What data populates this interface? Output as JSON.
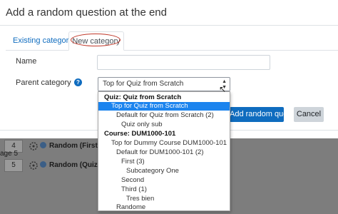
{
  "modal": {
    "title": "Add a random question at the end",
    "tabs": [
      {
        "label": "Existing category"
      },
      {
        "label": "New category"
      }
    ],
    "form": {
      "name_label": "Name",
      "name_value": "",
      "parent_label": "Parent category",
      "help_icon": "?",
      "parent_selected": "Top for Quiz from Scratch",
      "options": [
        {
          "label": "Quiz: Quiz from Scratch",
          "group": true
        },
        {
          "label": "Top for Quiz from Scratch",
          "selected": true
        },
        {
          "label": "Default for Quiz from Scratch (2)"
        },
        {
          "label": "Quiz only sub"
        },
        {
          "label": "Course: DUM1000-101",
          "group": true
        },
        {
          "label": "Top for Dummy Course DUM1000-101"
        },
        {
          "label": "Default for DUM1000-101 (2)"
        },
        {
          "label": "First (3)"
        },
        {
          "label": "Subcategory One"
        },
        {
          "label": "Second"
        },
        {
          "label": "Third (1)"
        },
        {
          "label": "Tres bien"
        },
        {
          "label": "Randome"
        }
      ]
    },
    "buttons": {
      "add_label": "Add random question",
      "cancel_label": "Cancel"
    }
  },
  "background": {
    "page_label": "age 5",
    "rows": [
      {
        "number": "4",
        "text": "Random (First) ..."
      },
      {
        "number": "5",
        "text": "Random (Quiz o"
      }
    ]
  },
  "colors": {
    "accent": "#0f6cbf",
    "selected": "#1c84ee",
    "highlight_ring": "#c0392b"
  }
}
